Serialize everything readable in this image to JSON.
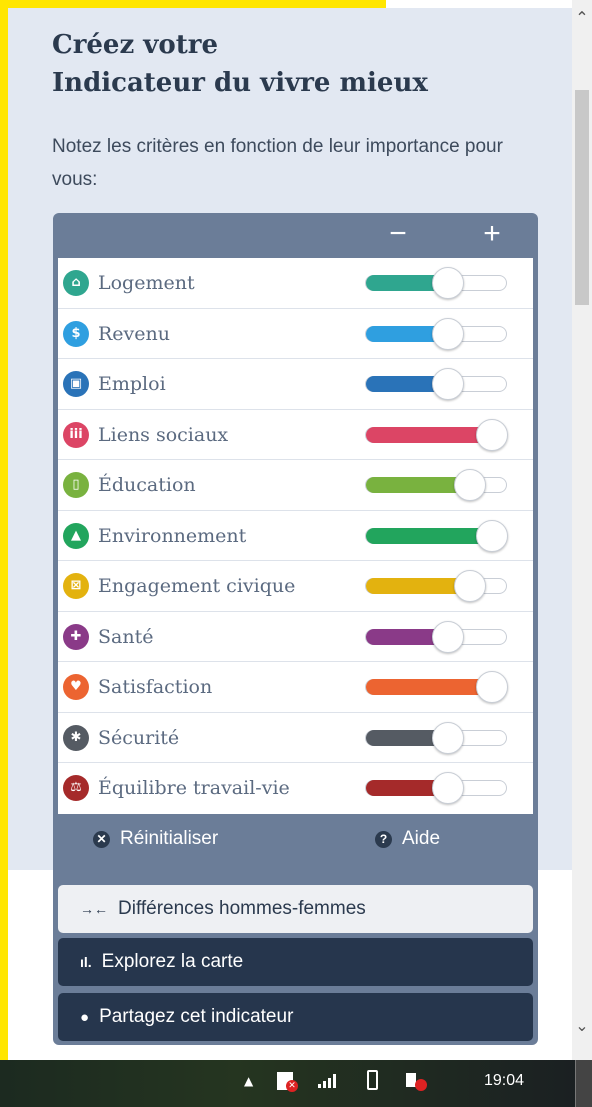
{
  "header": {
    "title_line1": "Créez votre",
    "title_line2": "Indicateur du vivre mieux",
    "subtitle": "Notez les critères en fonction de leur importance pour vous:"
  },
  "widget": {
    "minus": "−",
    "plus": "+",
    "criteria": [
      {
        "label": "Logement",
        "icon": "house-icon",
        "color": "#2fa68f",
        "level": 0.6
      },
      {
        "label": "Revenu",
        "icon": "money-icon",
        "color": "#2f9fe0",
        "level": 0.6
      },
      {
        "label": "Emploi",
        "icon": "briefcase-icon",
        "color": "#2a73b8",
        "level": 0.6
      },
      {
        "label": "Liens sociaux",
        "icon": "people-icon",
        "color": "#dc4565",
        "level": 1.0
      },
      {
        "label": "Éducation",
        "icon": "book-icon",
        "color": "#79b23f",
        "level": 0.8
      },
      {
        "label": "Environnement",
        "icon": "tree-icon",
        "color": "#22a55d",
        "level": 1.0
      },
      {
        "label": "Engagement civique",
        "icon": "ballot-icon",
        "color": "#e3b20f",
        "level": 0.8
      },
      {
        "label": "Santé",
        "icon": "cross-icon",
        "color": "#8a3a88",
        "level": 0.6
      },
      {
        "label": "Satisfaction",
        "icon": "heart-icon",
        "color": "#ec6431",
        "level": 1.0
      },
      {
        "label": "Sécurité",
        "icon": "runner-icon",
        "color": "#555b63",
        "level": 0.6
      },
      {
        "label": "Équilibre travail-vie",
        "icon": "scale-icon",
        "color": "#a52a2a",
        "level": 0.6
      }
    ],
    "reset": "Réinitialiser",
    "help": "Aide"
  },
  "actions": {
    "gender": "Différences hommes-femmes",
    "map": "Explorez la carte",
    "share": "Partagez cet indicateur"
  },
  "taskbar": {
    "clock": "19:04"
  }
}
